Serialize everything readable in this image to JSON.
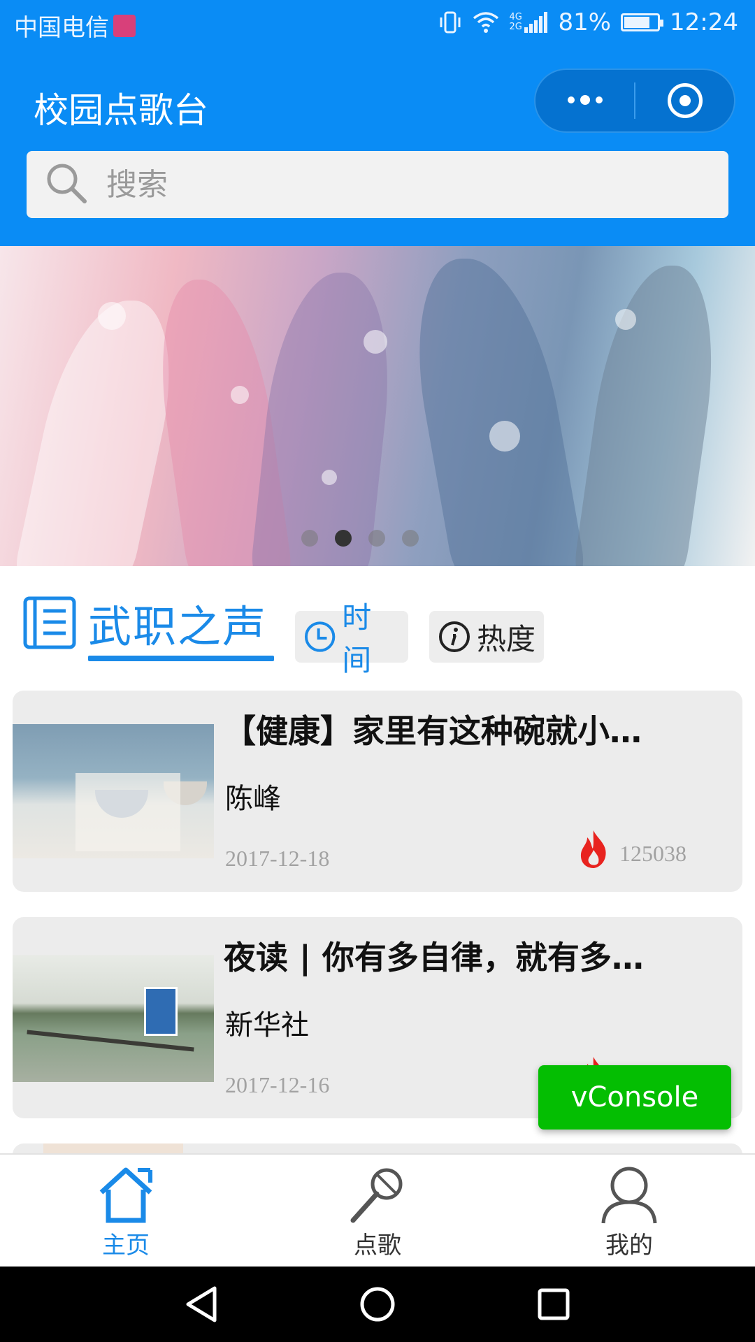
{
  "status_bar": {
    "carrier": "中国电信",
    "network": "4G 2G",
    "battery": "81%",
    "battery_level": 0.81,
    "time": "12:24"
  },
  "header": {
    "title": "校园点歌台"
  },
  "search": {
    "placeholder": "搜索"
  },
  "banner": {
    "slide_count": 4,
    "active_index": 1
  },
  "section": {
    "title": "武职之声",
    "sort_tabs": [
      {
        "label": "时间",
        "icon": "clock-icon",
        "active": true
      },
      {
        "label": "热度",
        "icon": "info-icon",
        "active": false
      }
    ]
  },
  "articles": [
    {
      "title": "【健康】家里有这种碗就小…",
      "author": "陈峰",
      "date": "2017-12-18",
      "hot": "125038"
    },
    {
      "title": "夜读 | 你有多自律，就有多…",
      "author": "新华社",
      "date": "2017-12-16",
      "hot": ""
    }
  ],
  "vconsole": {
    "label": "vConsole"
  },
  "tab_bar": [
    {
      "label": "主页",
      "icon": "home-icon",
      "active": true
    },
    {
      "label": "点歌",
      "icon": "microphone-icon",
      "active": false
    },
    {
      "label": "我的",
      "icon": "user-icon",
      "active": false
    }
  ],
  "colors": {
    "primary": "#0a8cf5",
    "accent": "#1a8ae8",
    "vconsole": "#04be02",
    "hot": "#e8231f"
  }
}
